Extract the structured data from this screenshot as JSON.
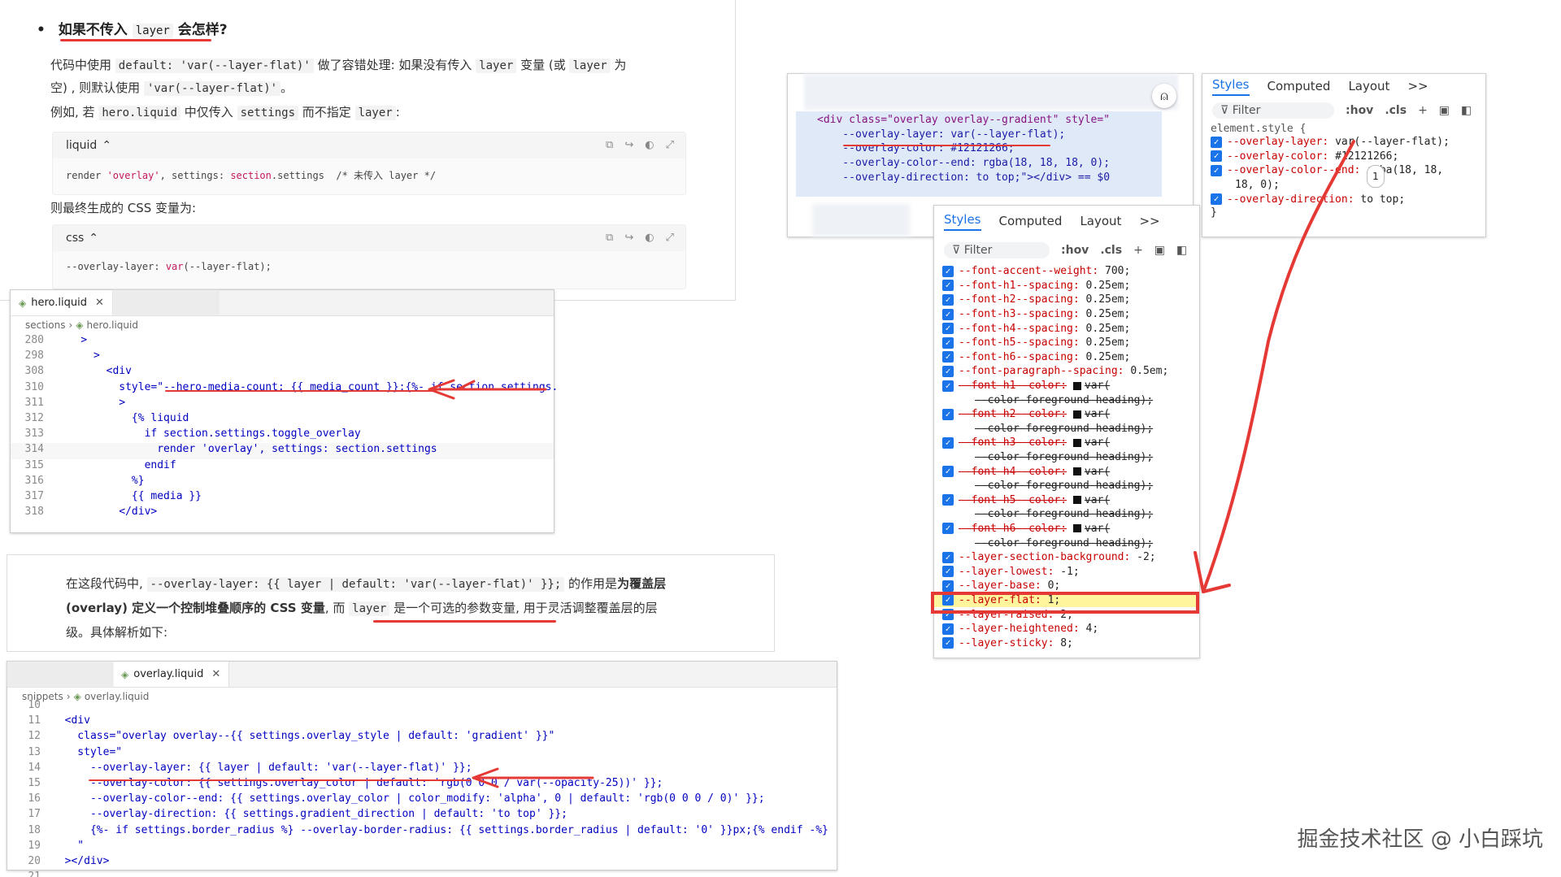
{
  "article": {
    "bullet_prefix": "如果不传入",
    "bullet_code": "layer",
    "bullet_suffix": "会怎样?",
    "p1": [
      "代码中使用 ",
      "default: 'var(--layer-flat)'",
      " 做了容错处理: 如果没有传入 ",
      "layer",
      " 变量 (或 ",
      "layer",
      " 为"
    ],
    "p2_a": "空) , 则默认使用 ",
    "p2_code": "'var(--layer-flat)'",
    "p2_b": "。",
    "p3": [
      "例如, 若 ",
      "hero.liquid",
      " 中仅传入 ",
      "settings",
      " 而不指定 ",
      "layer",
      ":"
    ],
    "block1": {
      "lang": "liquid",
      "code_a": "render ",
      "code_b": "'overlay'",
      "code_c": ", settings: ",
      "code_d": "section",
      "code_e": ".settings  /* 未传入 layer */"
    },
    "p4": "则最终生成的 CSS 变量为:",
    "block2": {
      "lang": "css",
      "code_a": "--overlay-layer: ",
      "code_b": "var",
      "code_c": "(--layer-flat);"
    }
  },
  "hero": {
    "tab": "hero.liquid",
    "crumb_folder": "sections",
    "crumb_file": "hero.liquid",
    "lines": [
      {
        "n": "280",
        "t": "    >"
      },
      {
        "n": "298",
        "t": "      >"
      },
      {
        "n": "308",
        "t": "        <div"
      },
      {
        "n": "310",
        "t": "          style=\"--hero-media-count: {{ media_count }};{%- if section.settings."
      },
      {
        "n": "311",
        "t": "          >"
      },
      {
        "n": "312",
        "t": "            {% liquid"
      },
      {
        "n": "313",
        "t": "              if section.settings.toggle_overlay"
      },
      {
        "n": "314",
        "t": "                render 'overlay', settings: section.settings"
      },
      {
        "n": "315",
        "t": "              endif"
      },
      {
        "n": "316",
        "t": "            %}"
      },
      {
        "n": "317",
        "t": "            {{ media }}"
      },
      {
        "n": "318",
        "t": "          </div>"
      }
    ]
  },
  "explain": {
    "l1_a": "在这段代码中, ",
    "l1_code": "--overlay-layer: {{ layer | default: 'var(--layer-flat)' }};",
    "l1_b": " 的作用是",
    "l1_bold": "为覆盖层",
    "l2_bold": "(overlay) 定义一个控制堆叠顺序的 CSS 变量",
    "l2_a": ", 而 ",
    "l2_code": "layer",
    "l2_b": " 是一个可选的参数变量",
    "l2_c": ", 用于灵活调整覆盖层的层",
    "l3": "级。具体解析如下:"
  },
  "overlay": {
    "tab": "overlay.liquid",
    "crumb_folder": "snippets",
    "crumb_file": "overlay.liquid",
    "lines": [
      {
        "n": "10",
        "t": ""
      },
      {
        "n": "11",
        "t": "  <div"
      },
      {
        "n": "12",
        "t": "    class=\"overlay overlay--{{ settings.overlay_style | default: 'gradient' }}\""
      },
      {
        "n": "13",
        "t": "    style=\""
      },
      {
        "n": "14",
        "t": "      --overlay-layer: {{ layer | default: 'var(--layer-flat)' }};"
      },
      {
        "n": "15",
        "t": "      --overlay-color: {{ settings.overlay_color | default: 'rgb(0 0 0 / var(--opacity-25))' }};"
      },
      {
        "n": "16",
        "t": "      --overlay-color--end: {{ settings.overlay_color | color_modify: 'alpha', 0 | default: 'rgb(0 0 0 / 0)' }};"
      },
      {
        "n": "17",
        "t": "      --overlay-direction: {{ settings.gradient_direction | default: 'to top' }};"
      },
      {
        "n": "18",
        "t": "      {%- if settings.border_radius %} --overlay-border-radius: {{ settings.border_radius | default: '0' }}px;{% endif -%}"
      },
      {
        "n": "19",
        "t": "    \""
      },
      {
        "n": "20",
        "t": "  ></div>"
      },
      {
        "n": "21",
        "t": ""
      }
    ]
  },
  "elements": {
    "lines": [
      "<div class=\"overlay overlay--gradient\" style=\"",
      "    --overlay-layer: var(--layer-flat);",
      "    --overlay-color: #12121266;",
      "    --overlay-color--end: rgba(18, 18, 18, 0);",
      "    --overlay-direction: to top;\"></div> == $0"
    ]
  },
  "devtools_top": {
    "tabs": [
      "Styles",
      "Computed",
      "Layout",
      ">>"
    ],
    "filter": "Filter",
    "hov": ":hov",
    "cls": ".cls",
    "selector": "element.style {",
    "props": [
      {
        "n": "--overlay-layer",
        "v": "var(--layer-flat);"
      },
      {
        "n": "--overlay-color",
        "v": "#12121266;"
      },
      {
        "n": "--overlay-color--end",
        "v": "rgba(18, 18,"
      },
      {
        "n": "",
        "v": "18, 0);"
      },
      {
        "n": "--overlay-direction",
        "v": "to top;"
      }
    ],
    "close": "}",
    "badge": "1"
  },
  "devtools_main": {
    "tabs": [
      "Styles",
      "Computed",
      "Layout",
      ">>"
    ],
    "filter": "Filter",
    "hov": ":hov",
    "cls": ".cls",
    "props": [
      {
        "n": "--font-accent--weight",
        "v": "700;"
      },
      {
        "n": "--font-h1--spacing",
        "v": "0.25em;"
      },
      {
        "n": "--font-h2--spacing",
        "v": "0.25em;"
      },
      {
        "n": "--font-h3--spacing",
        "v": "0.25em;"
      },
      {
        "n": "--font-h4--spacing",
        "v": "0.25em;"
      },
      {
        "n": "--font-h5--spacing",
        "v": "0.25em;"
      },
      {
        "n": "--font-h6--spacing",
        "v": "0.25em;"
      },
      {
        "n": "--font-paragraph--spacing",
        "v": "0.5em;"
      },
      {
        "n": "--font-h1--color",
        "v": "var(",
        "s": true
      },
      {
        "n": "",
        "v": "--color-foreground-heading);",
        "s": true,
        "cont": true
      },
      {
        "n": "--font-h2--color",
        "v": "var(",
        "s": true
      },
      {
        "n": "",
        "v": "--color-foreground-heading);",
        "s": true,
        "cont": true
      },
      {
        "n": "--font-h3--color",
        "v": "var(",
        "s": true
      },
      {
        "n": "",
        "v": "--color-foreground-heading);",
        "s": true,
        "cont": true
      },
      {
        "n": "--font-h4--color",
        "v": "var(",
        "s": true
      },
      {
        "n": "",
        "v": "--color-foreground-heading);",
        "s": true,
        "cont": true
      },
      {
        "n": "--font-h5--color",
        "v": "var(",
        "s": true
      },
      {
        "n": "",
        "v": "--color-foreground-heading);",
        "s": true,
        "cont": true
      },
      {
        "n": "--font-h6--color",
        "v": "var(",
        "s": true
      },
      {
        "n": "",
        "v": "--color-foreground-heading);",
        "s": true,
        "cont": true
      },
      {
        "n": "--layer-section-background",
        "v": "-2;"
      },
      {
        "n": "--layer-lowest",
        "v": "-1;"
      },
      {
        "n": "--layer-base",
        "v": "0;"
      },
      {
        "n": "--layer-flat",
        "v": "1;",
        "hl": true
      },
      {
        "n": "--layer-raised",
        "v": "2;"
      },
      {
        "n": "--layer-heightened",
        "v": "4;"
      },
      {
        "n": "--layer-sticky",
        "v": "8;"
      }
    ]
  },
  "watermark": "掘金技术社区 @ 小白踩坑",
  "colors": {
    "annotation": "#e53935",
    "accent": "#1a73e8",
    "highlight": "#fff59d"
  }
}
